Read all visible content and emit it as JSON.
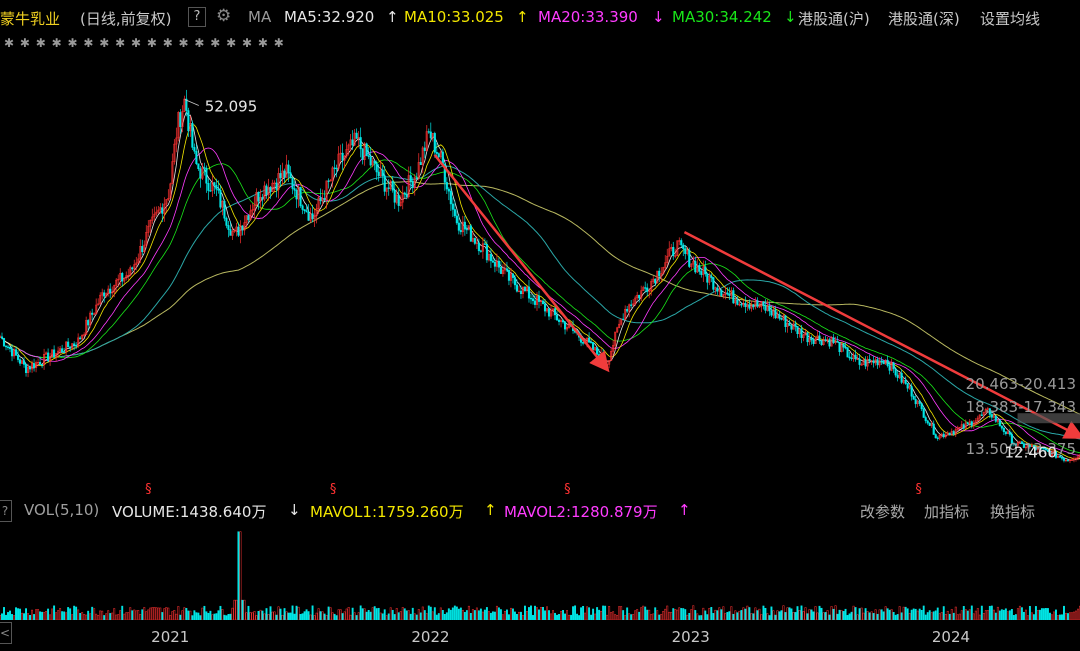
{
  "header": {
    "stock_name": "蒙牛乳业",
    "period": "(日线,前复权)",
    "help": "?",
    "ma_label": "MA",
    "ma5": "MA5:32.920",
    "ma5_arrow": "↑",
    "ma10": "MA10:33.025",
    "ma10_arrow": "↑",
    "ma20": "MA20:33.390",
    "ma20_arrow": "↓",
    "ma30": "MA30:34.242",
    "ma30_arrow": "↓",
    "hk_sh": "港股通(沪)",
    "hk_sz": "港股通(深)",
    "set_ma": "设置均线"
  },
  "colors": {
    "ma5": "#e6e6e6",
    "ma10": "#f2e600",
    "ma20": "#ff3cff",
    "ma30": "#19e619",
    "up": "#ff3232",
    "down": "#00e6e6",
    "arrow": "#f03c3c",
    "long_ma": "#b8b860",
    "mid_ma": "#2aa6a6"
  },
  "chart_data": {
    "type": "line",
    "title": "蒙牛乳业 日线 前复权",
    "x_ticks": [
      "2021",
      "2022",
      "2023",
      "2024"
    ],
    "x_start": "2020.35",
    "x_end": "2024.5",
    "ylim": [
      10,
      56
    ],
    "close_points": [
      {
        "t": 2020.35,
        "v": 26.0
      },
      {
        "t": 2020.45,
        "v": 22.5
      },
      {
        "t": 2020.55,
        "v": 24.0
      },
      {
        "t": 2020.65,
        "v": 25.5
      },
      {
        "t": 2020.75,
        "v": 31.0
      },
      {
        "t": 2020.85,
        "v": 33.0
      },
      {
        "t": 2020.92,
        "v": 37.5
      },
      {
        "t": 2021.0,
        "v": 42.0
      },
      {
        "t": 2021.03,
        "v": 49.0
      },
      {
        "t": 2021.06,
        "v": 52.095
      },
      {
        "t": 2021.1,
        "v": 45.0
      },
      {
        "t": 2021.18,
        "v": 42.0
      },
      {
        "t": 2021.25,
        "v": 37.0
      },
      {
        "t": 2021.35,
        "v": 42.0
      },
      {
        "t": 2021.45,
        "v": 44.0
      },
      {
        "t": 2021.55,
        "v": 39.0
      },
      {
        "t": 2021.65,
        "v": 45.0
      },
      {
        "t": 2021.72,
        "v": 47.5
      },
      {
        "t": 2021.8,
        "v": 44.0
      },
      {
        "t": 2021.88,
        "v": 41.0
      },
      {
        "t": 2021.95,
        "v": 44.0
      },
      {
        "t": 2022.0,
        "v": 48.5
      },
      {
        "t": 2022.05,
        "v": 45.0
      },
      {
        "t": 2022.1,
        "v": 39.0
      },
      {
        "t": 2022.2,
        "v": 36.0
      },
      {
        "t": 2022.3,
        "v": 32.5
      },
      {
        "t": 2022.45,
        "v": 29.0
      },
      {
        "t": 2022.6,
        "v": 25.5
      },
      {
        "t": 2022.68,
        "v": 23.0
      },
      {
        "t": 2022.75,
        "v": 29.0
      },
      {
        "t": 2022.85,
        "v": 32.0
      },
      {
        "t": 2022.95,
        "v": 36.0
      },
      {
        "t": 2023.05,
        "v": 33.0
      },
      {
        "t": 2023.15,
        "v": 30.5
      },
      {
        "t": 2023.3,
        "v": 29.0
      },
      {
        "t": 2023.45,
        "v": 26.0
      },
      {
        "t": 2023.55,
        "v": 25.5
      },
      {
        "t": 2023.65,
        "v": 23.0
      },
      {
        "t": 2023.75,
        "v": 23.5
      },
      {
        "t": 2023.85,
        "v": 20.0
      },
      {
        "t": 2023.95,
        "v": 15.0
      },
      {
        "t": 2024.05,
        "v": 16.0
      },
      {
        "t": 2024.15,
        "v": 17.8
      },
      {
        "t": 2024.25,
        "v": 14.2
      },
      {
        "t": 2024.35,
        "v": 13.6
      },
      {
        "t": 2024.45,
        "v": 12.46
      },
      {
        "t": 2024.5,
        "v": 13.0
      }
    ],
    "annotations": {
      "high_label": "52.095",
      "low_label": "12.460",
      "level1": "20.463-20.413",
      "level2": "18.383-17.343",
      "level3": "13.509-13.375",
      "level1_value": 20.44,
      "level2_value": 17.9,
      "level3_value": 13.4,
      "event_markers": [
        2020.3,
        2020.92,
        2021.63,
        2022.53,
        2023.88
      ]
    },
    "trend_arrows": [
      {
        "from": {
          "t": 2022.02,
          "v": 46.0
        },
        "to": {
          "t": 2022.68,
          "v": 22.5
        }
      },
      {
        "from": {
          "t": 2022.98,
          "v": 37.5
        },
        "to": {
          "t": 2024.5,
          "v": 15.0
        }
      }
    ]
  },
  "volume_panel": {
    "edge": "?",
    "label": "VOL(5,10)",
    "volume": "VOLUME:1438.640万",
    "volume_arrow": "↓",
    "mavol1": "MAVOL1:1759.260万",
    "mavol1_arrow": "↑",
    "mavol2": "MAVOL2:1280.879万",
    "mavol2_arrow": "↑",
    "btn_params": "改参数",
    "btn_add": "加指标",
    "btn_switch": "换指标",
    "spike_time": 2021.27,
    "edge_marker": "<",
    "volume_level": 0.12,
    "spike_level": 0.96
  },
  "row2_text": "✱ ✱ ✱ ✱ ✱ ✱ ✱ ✱ ✱ ✱ ✱ ✱ ✱ ✱ ✱ ✱ ✱ ✱"
}
